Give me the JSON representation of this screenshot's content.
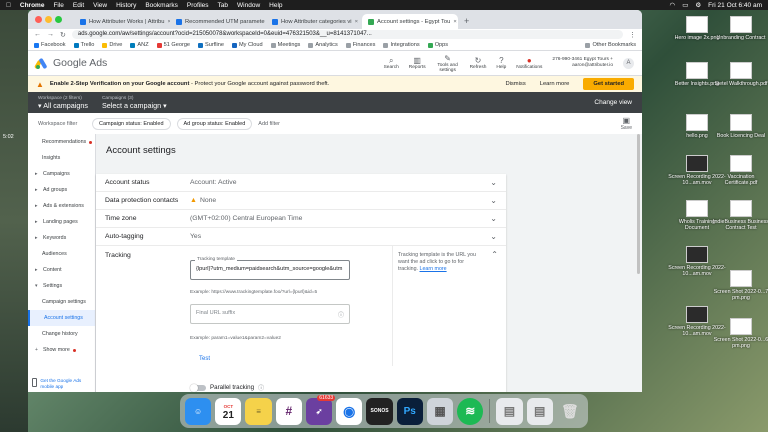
{
  "menubar": {
    "app": "Chrome",
    "items": [
      "File",
      "Edit",
      "View",
      "History",
      "Bookmarks",
      "Profiles",
      "Tab",
      "Window",
      "Help"
    ],
    "clock": "Fri 21 Oct  6:40 am"
  },
  "desktop_left_time": "5:02",
  "browser": {
    "tabs": [
      {
        "title": "How Attributer Works | Attribu"
      },
      {
        "title": "Recommended UTM paramete"
      },
      {
        "title": "How Attributer categories vi"
      },
      {
        "title": "Account settings - Egypt Tou"
      }
    ],
    "url": "ads.google.com/aw/settings/account?ocid=215050078&workspaceId=0&euid=476321503&__u=8141371047...",
    "bookmarks": [
      "Facebook",
      "Trello",
      "Drive",
      "ANZ",
      "51 George",
      "Surfline",
      "My Cloud",
      "Meetings",
      "Analytics",
      "Finances",
      "Integrations",
      "Opps"
    ],
    "other_bookmarks": "Other Bookmarks"
  },
  "gads": {
    "logo": "Google Ads",
    "tools": [
      {
        "label": "Search",
        "icon": "search-icon",
        "glyph": "⌕"
      },
      {
        "label": "Reports",
        "icon": "reports-icon",
        "glyph": "▥"
      },
      {
        "label": "Tools and settings",
        "icon": "wrench-icon",
        "glyph": "✎"
      },
      {
        "label": "Refresh",
        "icon": "refresh-icon",
        "glyph": "↻"
      },
      {
        "label": "Help",
        "icon": "help-icon",
        "glyph": "?"
      },
      {
        "label": "Notifications",
        "icon": "bell-icon",
        "glyph": "🔔"
      }
    ],
    "account_line1": "276-990-3461 Egypt Tours +",
    "account_line2": "aaron@attributer.io",
    "avatar": "A"
  },
  "notice": {
    "bold": "Enable 2-Step Verification on your Google account",
    "text": " - Protect your Google account against password theft.",
    "dismiss": "Dismiss",
    "learn_more": "Learn more",
    "cta": "Get started"
  },
  "campaign_bar": {
    "workspace_small": "Workspace (2 filters)",
    "workspace_big": "All campaigns",
    "campaigns_small": "Campaigns (3)",
    "campaigns_big": "Select a campaign",
    "change_view": "Change view"
  },
  "filters": {
    "label": "Workspace filter",
    "chips": [
      "Campaign status: Enabled",
      "Ad group status: Enabled"
    ],
    "add": "Add filter",
    "save": "Save"
  },
  "sidebar": {
    "items": [
      {
        "label": "Recommendations",
        "type": "sub",
        "dot": true
      },
      {
        "label": "Insights",
        "type": "sub"
      },
      {
        "label": "Campaigns",
        "type": "top"
      },
      {
        "label": "Ad groups",
        "type": "top"
      },
      {
        "label": "Ads & extensions",
        "type": "top"
      },
      {
        "label": "Landing pages",
        "type": "top"
      },
      {
        "label": "Keywords",
        "type": "top"
      },
      {
        "label": "Audiences",
        "type": "sub"
      },
      {
        "label": "Content",
        "type": "top"
      },
      {
        "label": "Settings",
        "type": "top-open"
      },
      {
        "label": "Campaign settings",
        "type": "sub"
      },
      {
        "label": "Account settings",
        "type": "active"
      },
      {
        "label": "Change history",
        "type": "sub"
      }
    ],
    "show_more": "Show more",
    "mobile_app": "Get the Google Ads mobile app"
  },
  "page_title": "Account settings",
  "settings": {
    "rows": [
      {
        "label": "Account status",
        "value": "Account: Active",
        "warn": false
      },
      {
        "label": "Data protection contacts",
        "value": "None",
        "warn": true
      },
      {
        "label": "Time zone",
        "value": "(GMT+02:00) Central European Time",
        "warn": false
      },
      {
        "label": "Auto-tagging",
        "value": "Yes",
        "warn": false
      }
    ],
    "tracking": {
      "label": "Tracking",
      "template_label": "Tracking template",
      "template_value": "{lpurl}?utm_medium=paidsearch&utm_source=google&utm",
      "template_example": "Example: https://www.trackingtemplate.foo/?url={lpurl}&id=5",
      "suffix_placeholder": "Final URL suffix",
      "suffix_example": "Example: param1=value1&param2=value2",
      "test": "Test",
      "help_text": "Tracking template is the URL you want the ad click to go to for tracking.",
      "help_link": "Learn more",
      "parallel": "Parallel tracking"
    }
  },
  "dock": {
    "apps": [
      {
        "name": "finder-app",
        "color": "#2d8ff0",
        "glyph": "☺"
      },
      {
        "name": "calendar-app",
        "color": "#ffffff",
        "glyph": "21",
        "text_color": "#e53935"
      },
      {
        "name": "notes-app",
        "color": "#f5d24a",
        "glyph": "≡"
      },
      {
        "name": "slack-app",
        "color": "#ffffff",
        "glyph": "#",
        "text_color": "#611f69"
      },
      {
        "name": "rocket-app",
        "color": "#6b3fa0",
        "glyph": "➶",
        "badge": "61633"
      },
      {
        "name": "chrome-app",
        "color": "#ffffff",
        "glyph": "◉",
        "text_color": "#1a73e8"
      },
      {
        "name": "sonos-app",
        "color": "#222222",
        "glyph": "SONOS"
      },
      {
        "name": "photoshop-app",
        "color": "#0a1f3a",
        "glyph": "Ps",
        "text_color": "#31a8ff"
      },
      {
        "name": "launchpad-app",
        "color": "#cfd4da",
        "glyph": "▦",
        "text_color": "#555"
      },
      {
        "name": "spotify-app",
        "color": "#1db954",
        "glyph": "≋"
      }
    ],
    "calendar_month": "OCT"
  },
  "desktop_icons": [
    {
      "label": "Hero image 2x.png",
      "dark": false
    },
    {
      "label": "Unbranding Contract",
      "dark": false
    },
    {
      "label": "Better Insights.png",
      "dark": false
    },
    {
      "label": "Sietel Walkthrough.pdf",
      "dark": false
    },
    {
      "label": "hello.png",
      "dark": false
    },
    {
      "label": "Book Licencing Deal",
      "dark": false
    },
    {
      "label": "Screen Recording 2022-10...am.mov",
      "dark": true
    },
    {
      "label": "Vaccination Certificate.pdf",
      "dark": false
    },
    {
      "label": "Wholis Training Document",
      "dark": false
    },
    {
      "label": "IndieBusiness Business Contract Test",
      "dark": false
    },
    {
      "label": "Screen Recording 2022-10...am.mov",
      "dark": true
    },
    {
      "label": "Screen Shot 2022-0...7 pm.png",
      "dark": false
    },
    {
      "label": "Screen Recording 2022-10...am.mov",
      "dark": true
    },
    {
      "label": "Screen Shot 2022-0...6 pm.png",
      "dark": false
    }
  ]
}
